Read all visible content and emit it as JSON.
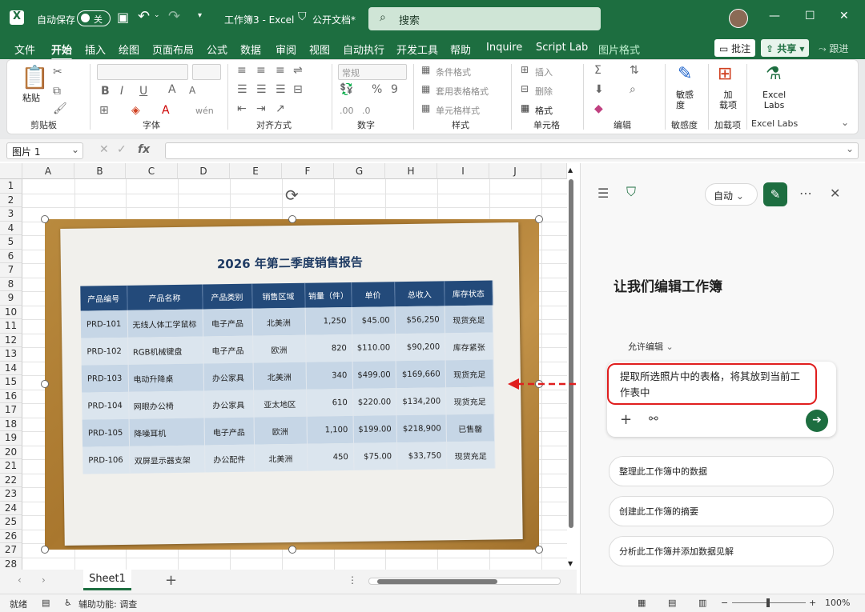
{
  "titlebar": {
    "autosave_label": "自动保存",
    "autosave_state": "关",
    "doc_title": "工作簿3 - Excel",
    "sensitivity": "公开文档*",
    "search_placeholder": "搜索"
  },
  "menu": {
    "tabs": [
      "文件",
      "开始",
      "插入",
      "绘图",
      "页面布局",
      "公式",
      "数据",
      "审阅",
      "视图",
      "自动执行",
      "开发工具",
      "帮助",
      "Inquire",
      "Script Lab",
      "图片格式"
    ],
    "active": "开始",
    "comments_btn": "批注",
    "share_btn": "共享",
    "catchup_btn": "跟进"
  },
  "ribbon": {
    "groups": [
      "剪贴板",
      "字体",
      "对齐方式",
      "数字",
      "样式",
      "单元格",
      "编辑",
      "敏感度",
      "加载项",
      "Excel Labs"
    ],
    "paste": "粘贴",
    "number_format": "常规",
    "styles": [
      "条件格式",
      "套用表格格式",
      "单元格样式"
    ],
    "cells": [
      "插入",
      "删除",
      "格式"
    ],
    "sensitivity_label": "敏感\n度",
    "addins_label": "加\n载项",
    "labs_label": "Excel\nLabs"
  },
  "formula_bar": {
    "name_box": "图片 1",
    "fx": "fx",
    "formula": ""
  },
  "grid": {
    "columns": [
      "A",
      "B",
      "C",
      "D",
      "E",
      "F",
      "G",
      "H",
      "I",
      "J"
    ],
    "rows": [
      "1",
      "2",
      "3",
      "4",
      "5",
      "6",
      "7",
      "8",
      "9",
      "10",
      "11",
      "12",
      "13",
      "14",
      "15",
      "16",
      "17",
      "18",
      "19",
      "20",
      "21",
      "22",
      "23",
      "24",
      "25",
      "26",
      "27",
      "28"
    ]
  },
  "photo": {
    "title": "2026 年第二季度销售报告",
    "headers": [
      "产品编号",
      "产品名称",
      "产品类别",
      "销售区域",
      "销量（件）",
      "单价",
      "总收入",
      "库存状态"
    ],
    "rows": [
      [
        "PRD-101",
        "无线人体工学鼠标",
        "电子产品",
        "北美洲",
        "1,250",
        "$45.00",
        "$56,250",
        "现货充足"
      ],
      [
        "PRD-102",
        "RGB机械键盘",
        "电子产品",
        "欧洲",
        "820",
        "$110.00",
        "$90,200",
        "库存紧张"
      ],
      [
        "PRD-103",
        "电动升降桌",
        "办公家具",
        "北美洲",
        "340",
        "$499.00",
        "$169,660",
        "现货充足"
      ],
      [
        "PRD-104",
        "网眼办公椅",
        "办公家具",
        "亚太地区",
        "610",
        "$220.00",
        "$134,200",
        "现货充足"
      ],
      [
        "PRD-105",
        "降噪耳机",
        "电子产品",
        "欧洲",
        "1,100",
        "$199.00",
        "$218,900",
        "已售罄"
      ],
      [
        "PRD-106",
        "双屏显示器支架",
        "办公配件",
        "北美洲",
        "450",
        "$75.00",
        "$33,750",
        "现货充足"
      ]
    ]
  },
  "sheets": {
    "active": "Sheet1"
  },
  "status": {
    "ready": "就绪",
    "accessibility": "辅助功能: 调查",
    "zoom": "100%"
  },
  "copilot": {
    "mode": "自动",
    "heading": "让我们编辑工作簿",
    "permission": "允许编辑",
    "prompt": "提取所选照片中的表格，将其放到当前工作表中",
    "suggestions": [
      "整理此工作簿中的数据",
      "创建此工作簿的摘要",
      "分析此工作簿并添加数据见解"
    ]
  },
  "colors": {
    "excel_green": "#1d6e40",
    "table_header": "#234a7a",
    "highlight_red": "#e01e1e"
  }
}
